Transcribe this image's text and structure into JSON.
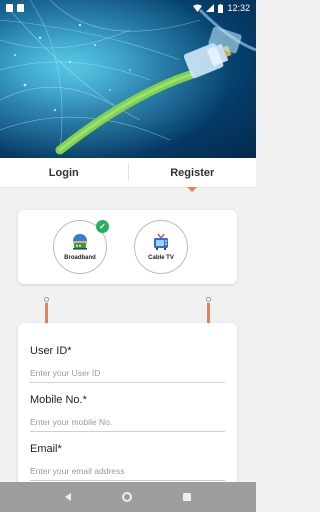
{
  "status_bar": {
    "time": "12:32"
  },
  "tabs": [
    {
      "label": "Login",
      "active": false
    },
    {
      "label": "Register",
      "active": true
    }
  ],
  "services": [
    {
      "label": "Broadband",
      "selected": true
    },
    {
      "label": "Cable TV",
      "selected": false
    }
  ],
  "form": {
    "fields": [
      {
        "label": "User ID*",
        "placeholder": "Enter your User ID",
        "value": ""
      },
      {
        "label": "Mobile No.*",
        "placeholder": "Enter your mobile No.",
        "value": ""
      },
      {
        "label": "Email*",
        "placeholder": "Enter your email address",
        "value": ""
      }
    ]
  },
  "colors": {
    "accent": "#ee7d52",
    "selected_check": "#27ae60",
    "nav_bar": "#9e9e9e"
  }
}
